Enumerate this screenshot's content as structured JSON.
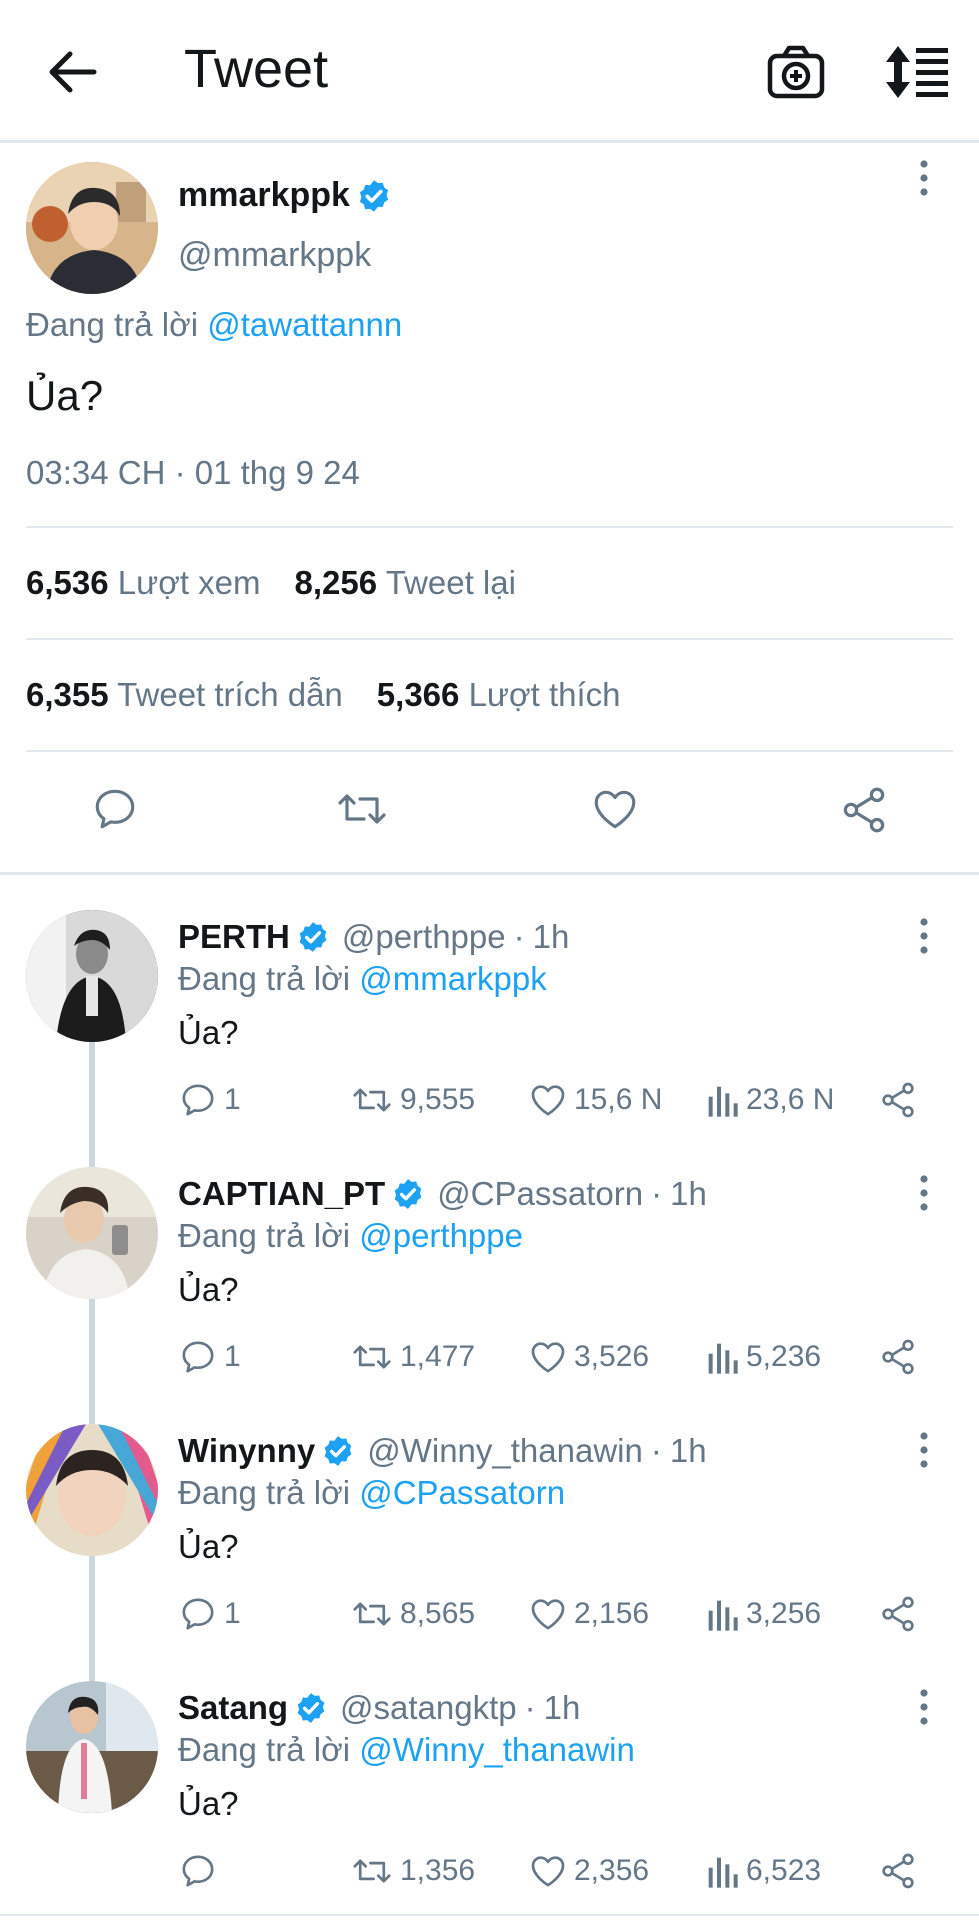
{
  "header": {
    "title": "Tweet"
  },
  "main_tweet": {
    "display_name": "mmarkppk",
    "handle": "@mmarkppk",
    "reply_prefix": "Đang trả lời",
    "reply_to": "@tawattannn",
    "text": "Ủa?",
    "timestamp": "03:34 CH · 01 thg 9 24",
    "stats": {
      "views_count": "6,536",
      "views_label": "Lượt xem",
      "retweets_count": "8,256",
      "retweets_label": "Tweet lại",
      "quotes_count": "6,355",
      "quotes_label": "Tweet trích dẫn",
      "likes_count": "5,366",
      "likes_label": "Lượt thích"
    }
  },
  "replies": [
    {
      "display_name": "PERTH",
      "handle": "@perthppe",
      "time": "1h",
      "reply_prefix": "Đang trả lời",
      "reply_to": "@mmarkppk",
      "text": "Ủa?",
      "reply_count": "1",
      "retweet_count": "9,555",
      "like_count": "15,6 N",
      "view_count": "23,6 N"
    },
    {
      "display_name": "CAPTIAN_PT",
      "handle": "@CPassatorn",
      "time": "1h",
      "reply_prefix": "Đang trả lời",
      "reply_to": "@perthppe",
      "text": "Ủa?",
      "reply_count": "1",
      "retweet_count": "1,477",
      "like_count": "3,526",
      "view_count": "5,236"
    },
    {
      "display_name": "Winynny",
      "handle": "@Winny_thanawin",
      "time": "1h",
      "reply_prefix": "Đang trả lời",
      "reply_to": "@CPassatorn",
      "text": "Ủa?",
      "reply_count": "1",
      "retweet_count": "8,565",
      "like_count": "2,156",
      "view_count": "3,256"
    },
    {
      "display_name": "Satang",
      "handle": "@satangktp",
      "time": "1h",
      "reply_prefix": "Đang trả lời",
      "reply_to": "@Winny_thanawin",
      "text": "Ủa?",
      "reply_count": "",
      "retweet_count": "1,356",
      "like_count": "2,356",
      "view_count": "6,523"
    }
  ],
  "colors": {
    "accent": "#1da1f2",
    "secondary_text": "#657786",
    "divider": "#e1e8ed"
  },
  "icons": [
    "back-arrow-icon",
    "camera-plus-icon",
    "sort-icon",
    "verified-icon",
    "more-vertical-icon",
    "reply-icon",
    "retweet-icon",
    "like-icon",
    "share-icon",
    "views-icon"
  ]
}
